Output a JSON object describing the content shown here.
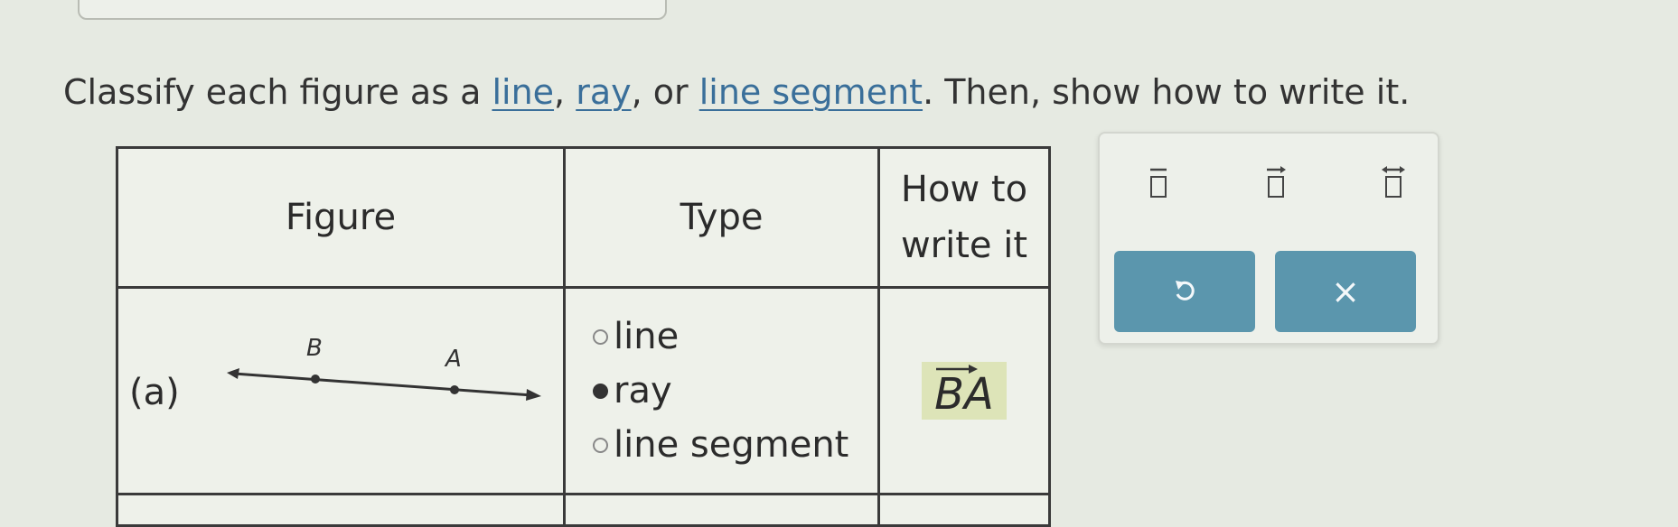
{
  "instruction": {
    "prefix": "Classify each figure as a ",
    "link_line": "line",
    "sep1": ", ",
    "link_ray": "ray",
    "sep2": ", or ",
    "link_segment": "line segment",
    "suffix": ". Then, show how to write it."
  },
  "table": {
    "headers": {
      "figure": "Figure",
      "type": "Type",
      "howto_line1": "How to",
      "howto_line2": "write it"
    },
    "rows": [
      {
        "label": "(a)",
        "point_b": "B",
        "point_a": "A",
        "options": [
          {
            "label": "line",
            "selected": false
          },
          {
            "label": "ray",
            "selected": true
          },
          {
            "label": "line segment",
            "selected": false
          }
        ],
        "answer": "BA",
        "answer_notation": "ray",
        "answer_highlight": "#dde4b8"
      }
    ]
  },
  "tools": {
    "symbols": [
      "segment-symbol-icon",
      "ray-symbol-icon",
      "line-symbol-icon"
    ],
    "undo_icon": "undo-icon",
    "clear_icon": "clear-x-icon",
    "clear_label": "×",
    "button_color": "#5b96ad"
  }
}
